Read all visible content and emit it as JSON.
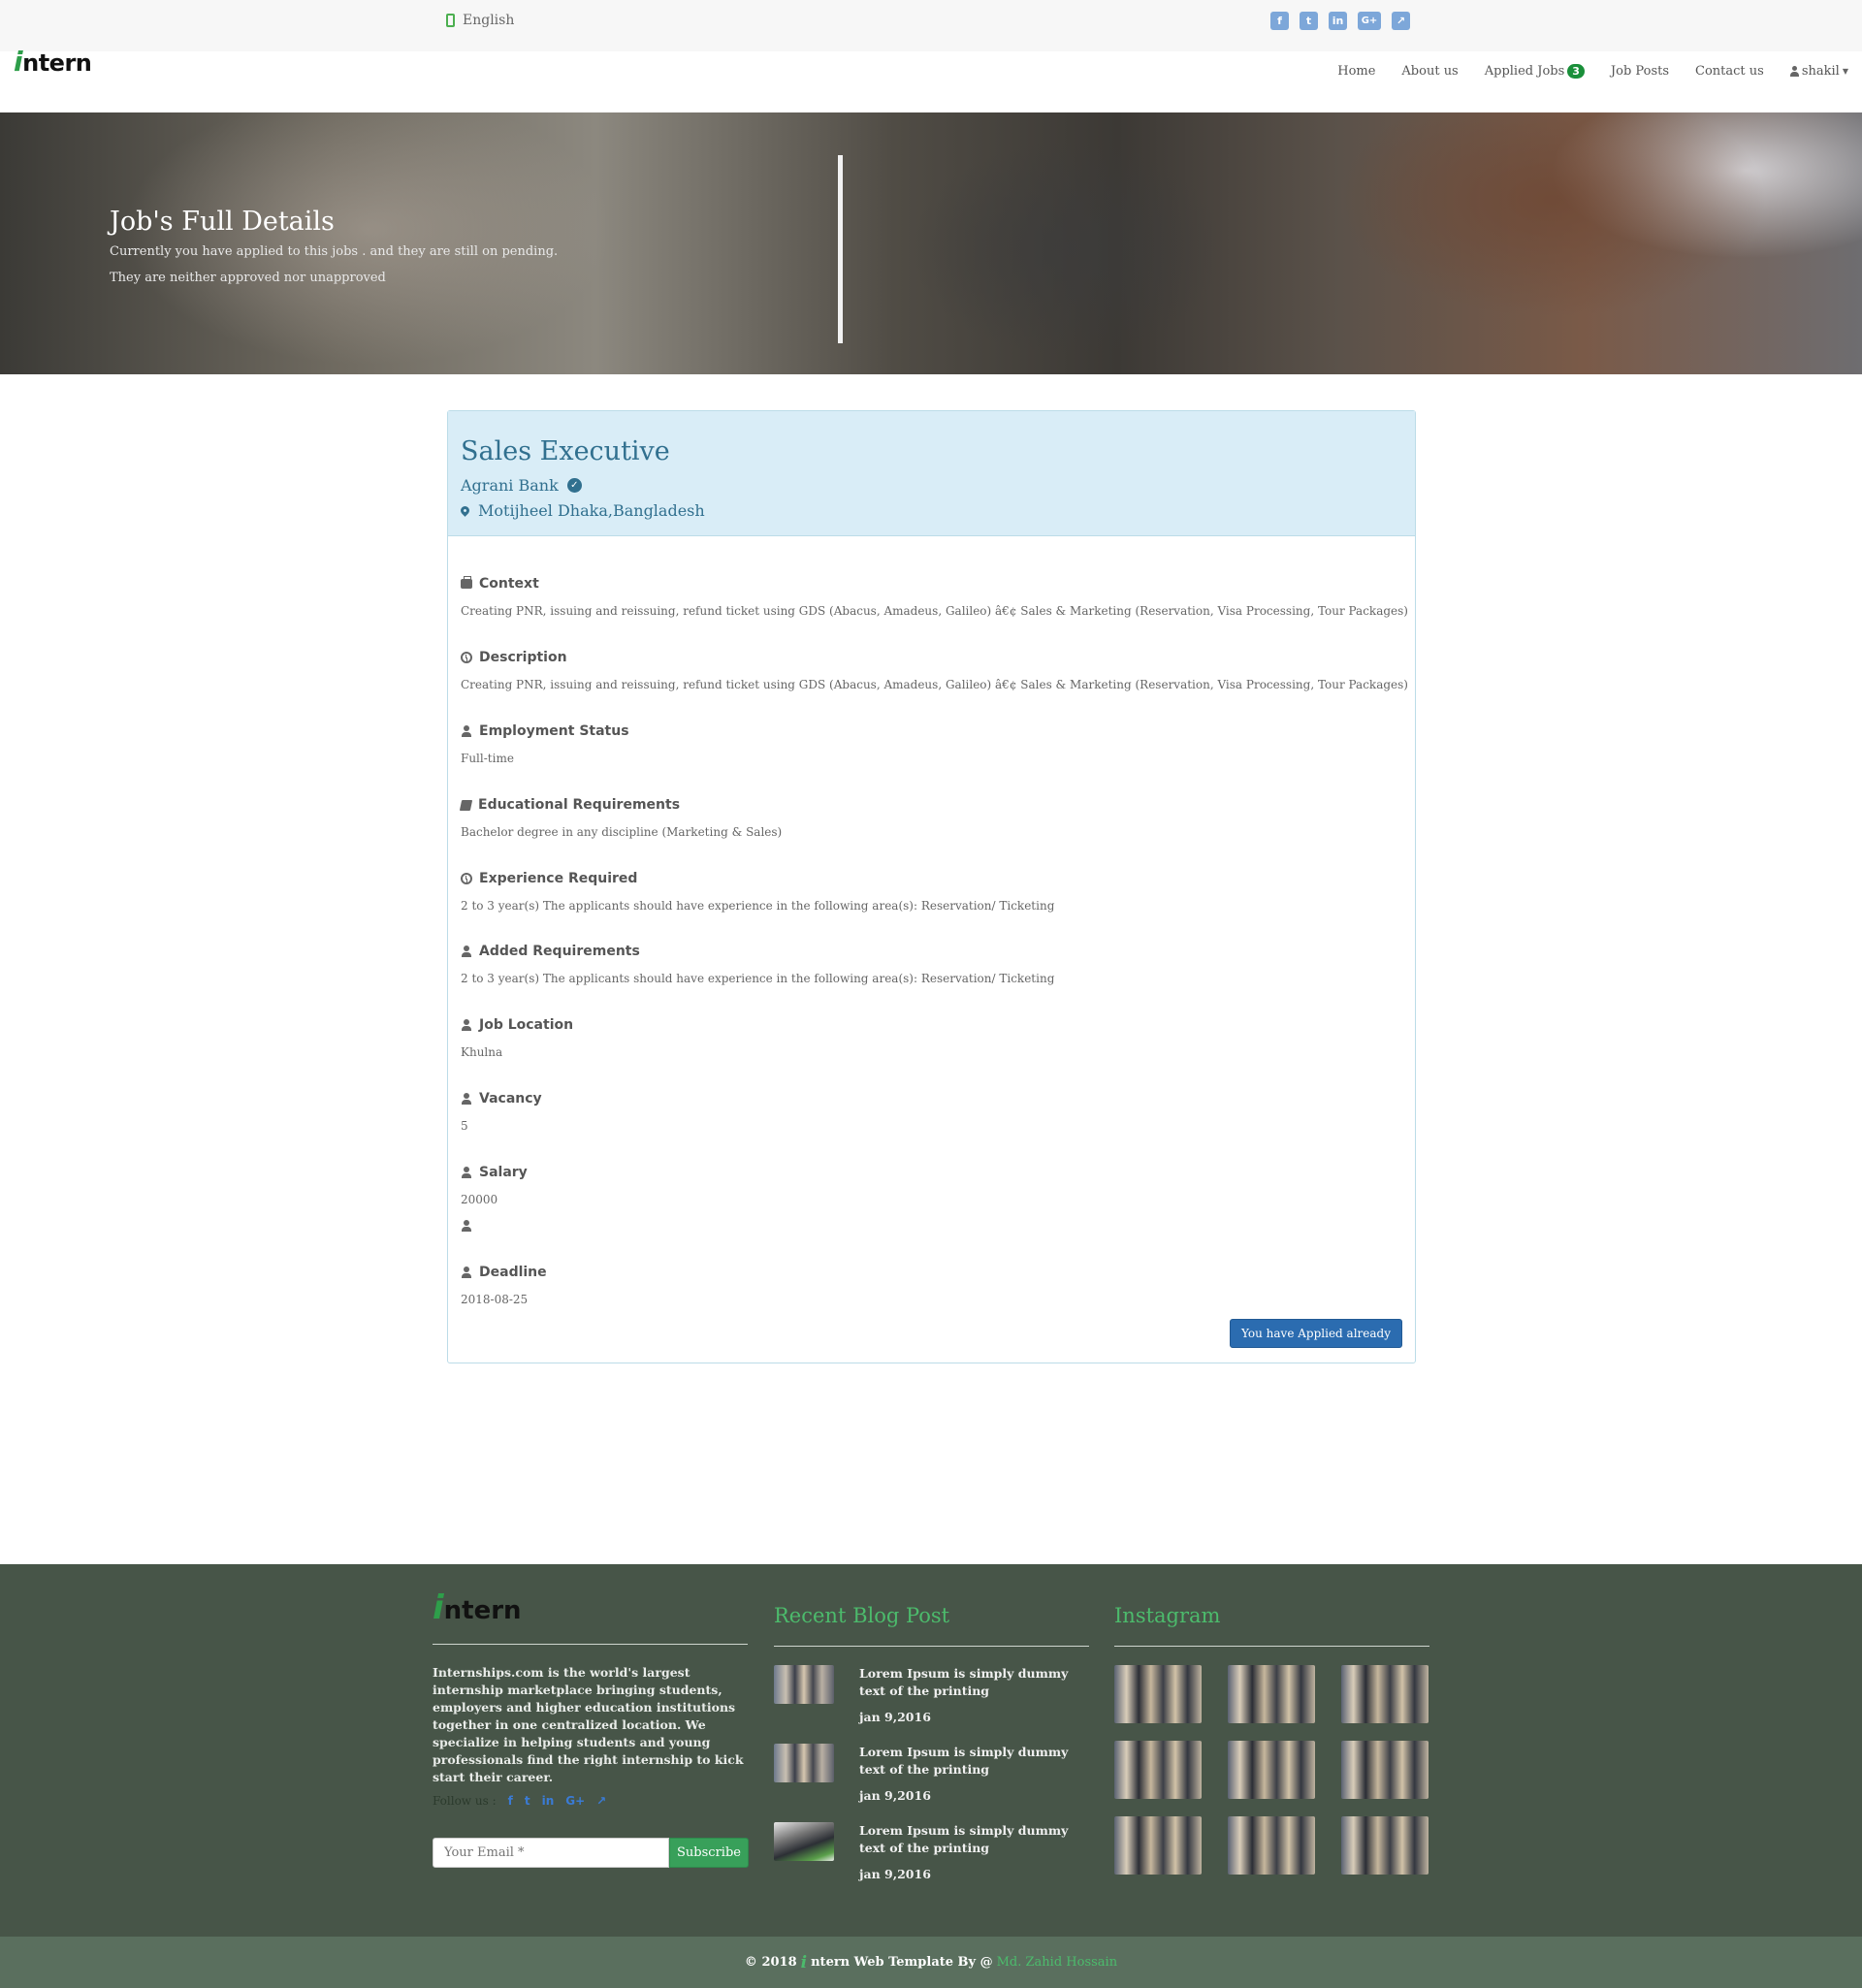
{
  "topbar": {
    "language": "English",
    "socials": [
      "f",
      "t",
      "in",
      "G+",
      "share"
    ]
  },
  "brand": {
    "logo_i": "i",
    "logo_rest": "ntern"
  },
  "nav": {
    "home": "Home",
    "about": "About us",
    "applied": "Applied Jobs",
    "applied_count": "3",
    "job_posts": "Job Posts",
    "contact": "Contact us",
    "user": "shakil"
  },
  "hero": {
    "title": "Job's Full Details",
    "line1": "Currently you have applied to this jobs . and they are still on pending.",
    "line2": "They are neither approved nor unapproved"
  },
  "job": {
    "title": "Sales Executive",
    "company": "Agrani Bank",
    "location": "Motijheel Dhaka,Bangladesh",
    "sections": [
      {
        "icon": "briefcase-icon",
        "label": "Context",
        "value": "Creating PNR, issuing and reissuing, refund ticket using GDS (Abacus, Amadeus, Galileo) â€¢ Sales & Marketing (Reservation, Visa Processing, Tour Packages)"
      },
      {
        "icon": "clock-icon",
        "label": "Description",
        "value": "Creating PNR, issuing and reissuing, refund ticket using GDS (Abacus, Amadeus, Galileo) â€¢ Sales & Marketing (Reservation, Visa Processing, Tour Packages)"
      },
      {
        "icon": "user-icon",
        "label": "Employment Status",
        "value": "Full-time"
      },
      {
        "icon": "book-icon",
        "label": "Educational Requirements",
        "value": "Bachelor degree in any discipline (Marketing & Sales)"
      },
      {
        "icon": "clock-icon",
        "label": "Experience Required",
        "value": "2 to 3 year(s) The applicants should have experience in the following area(s): Reservation/ Ticketing"
      },
      {
        "icon": "user-icon",
        "label": "Added Requirements",
        "value": "2 to 3 year(s) The applicants should have experience in the following area(s): Reservation/ Ticketing"
      },
      {
        "icon": "user-icon",
        "label": "Job Location",
        "value": "Khulna"
      },
      {
        "icon": "user-icon",
        "label": "Vacancy",
        "value": "5"
      },
      {
        "icon": "user-icon",
        "label": "Salary",
        "value": "20000"
      },
      {
        "icon": "user-icon",
        "label": "Deadline",
        "value": "2018-08-25"
      }
    ],
    "applied_button": "You have Applied already"
  },
  "footer": {
    "about": "Internships.com is the world's largest internship marketplace bringing students, employers and higher education institutions together in one centralized location. We specialize in helping students and young professionals find the right internship to kick start their career.",
    "follow_label": "Follow us :",
    "follow_icons": [
      "f",
      "t",
      "in",
      "G+",
      "share"
    ],
    "email_placeholder": "Your Email *",
    "subscribe": "Subscribe",
    "blog_title": "Recent Blog Post",
    "posts": [
      {
        "title": "Lorem Ipsum is simply dummy text of the printing",
        "date": "jan 9,2016"
      },
      {
        "title": "Lorem Ipsum is simply dummy text of the printing",
        "date": "jan 9,2016"
      },
      {
        "title": "Lorem Ipsum is simply dummy text of the printing",
        "date": "jan 9,2016"
      }
    ],
    "instagram_title": "Instagram",
    "copyright_prefix": "© 2018",
    "copyright_mid": "ntern Web Template By @",
    "copyright_author": "Md. Zahid Hossain"
  },
  "colors": {
    "accent_green": "#2e9e4a",
    "panel_blue": "#31708f",
    "panel_bg": "#d9edf7",
    "footer_bg": "#475548",
    "button_blue": "#2b6cb0"
  }
}
